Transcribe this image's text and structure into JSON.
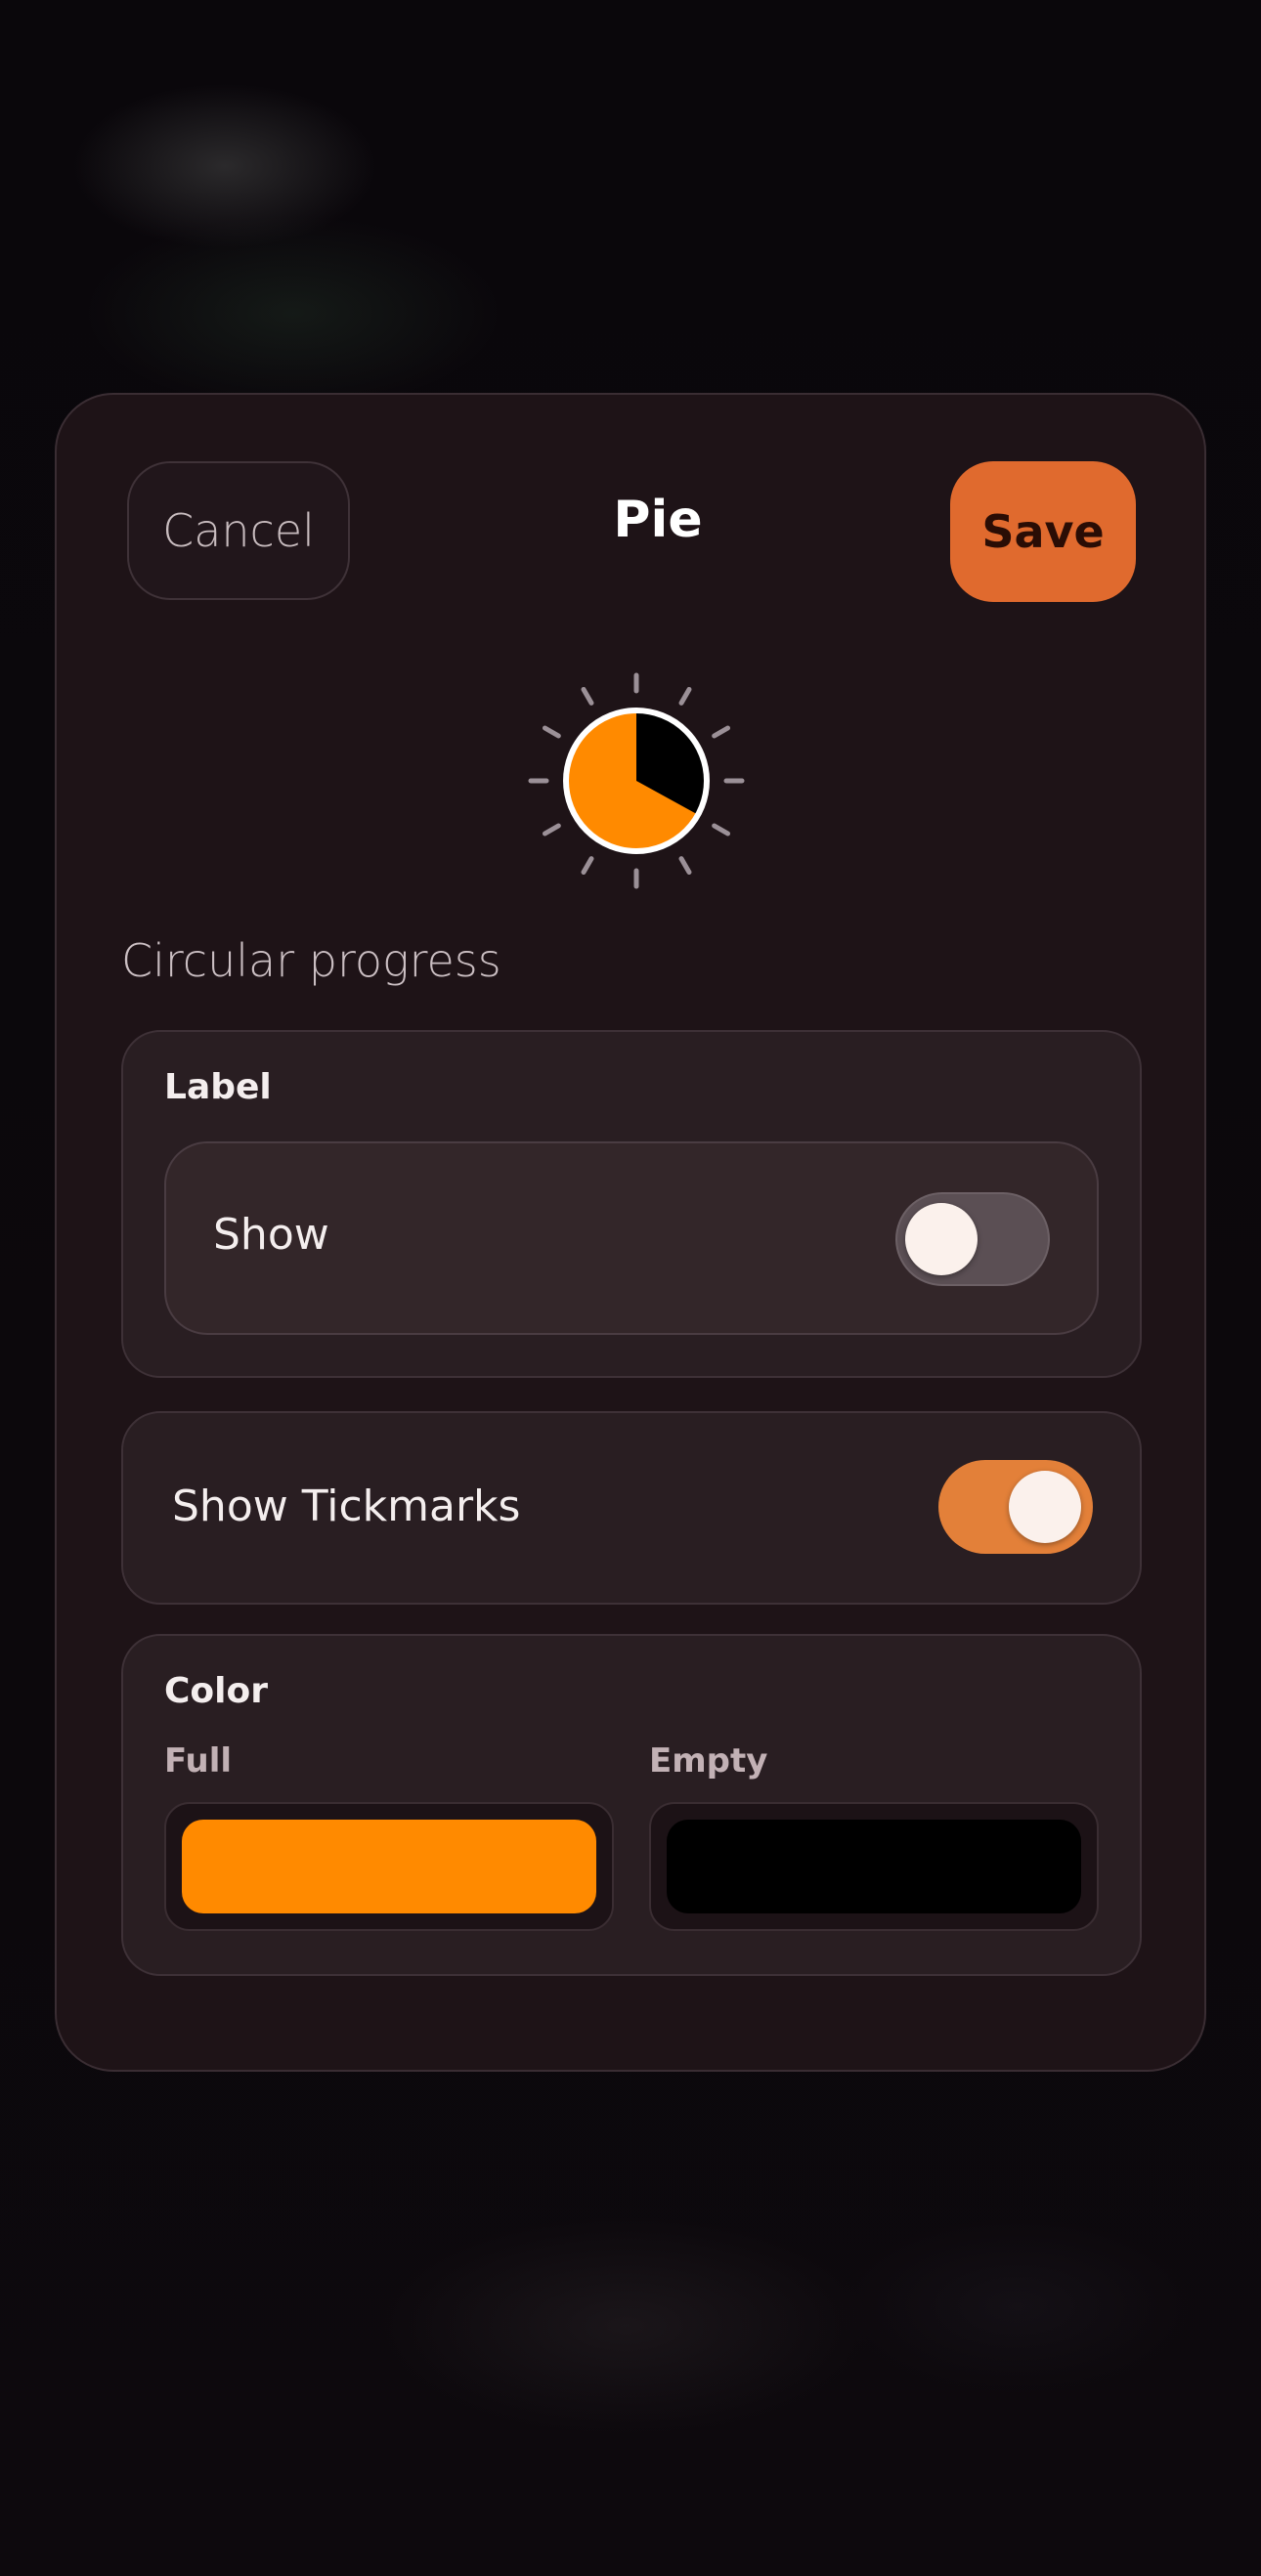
{
  "header": {
    "cancel_label": "Cancel",
    "title": "Pie",
    "save_label": "Save"
  },
  "preview": {
    "progress_fraction": 0.67,
    "full_color": "#ff8a00",
    "empty_color": "#000000",
    "tickmark_count": 12,
    "icon": "pie-progress-icon"
  },
  "section": {
    "caption": "Circular progress"
  },
  "label_card": {
    "title": "Label",
    "show_label": "Show",
    "show_enabled": false
  },
  "tickmarks_card": {
    "label": "Show Tickmarks",
    "enabled": true
  },
  "color_card": {
    "title": "Color",
    "full_label": "Full",
    "empty_label": "Empty",
    "full_color": "#ff8a00",
    "empty_color": "#000000"
  },
  "colors": {
    "accent": "#e06a2e",
    "toggle_on": "#e38039",
    "sheet_background": "#1e1317"
  }
}
